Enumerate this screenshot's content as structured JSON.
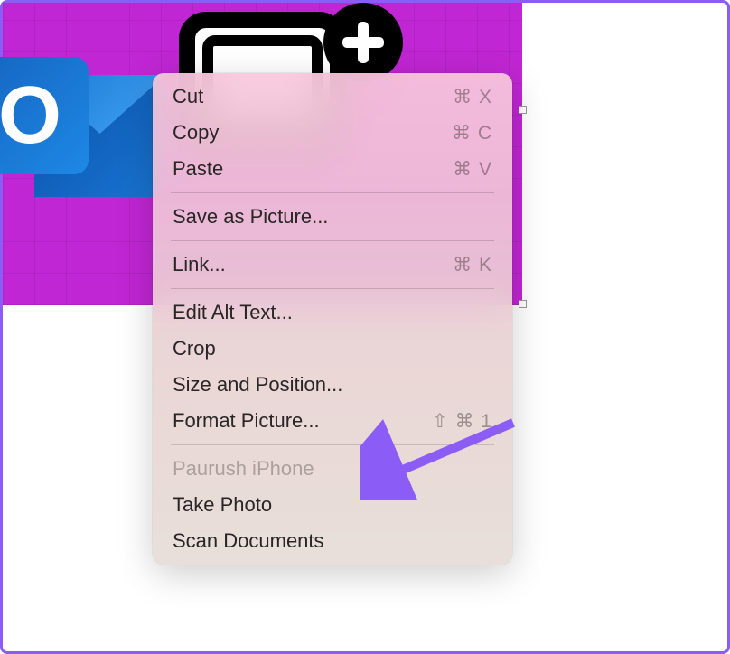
{
  "menu": {
    "items": [
      {
        "label": "Cut",
        "shortcut": "⌘ X",
        "enabled": true
      },
      {
        "label": "Copy",
        "shortcut": "⌘ C",
        "enabled": true
      },
      {
        "label": "Paste",
        "shortcut": "⌘ V",
        "enabled": true
      }
    ],
    "group2": [
      {
        "label": "Save as Picture...",
        "shortcut": "",
        "enabled": true
      }
    ],
    "group3": [
      {
        "label": "Link...",
        "shortcut": "⌘ K",
        "enabled": true
      }
    ],
    "group4": [
      {
        "label": "Edit Alt Text...",
        "shortcut": "",
        "enabled": true
      },
      {
        "label": "Crop",
        "shortcut": "",
        "enabled": true
      },
      {
        "label": "Size and Position...",
        "shortcut": "",
        "enabled": true
      },
      {
        "label": "Format Picture...",
        "shortcut": "⇧ ⌘ 1",
        "enabled": true
      }
    ],
    "group5": [
      {
        "label": "Paurush iPhone",
        "shortcut": "",
        "enabled": false
      },
      {
        "label": "Take Photo",
        "shortcut": "",
        "enabled": true
      },
      {
        "label": "Scan Documents",
        "shortcut": "",
        "enabled": true
      }
    ]
  },
  "icons": {
    "outlook_letter": "O"
  }
}
